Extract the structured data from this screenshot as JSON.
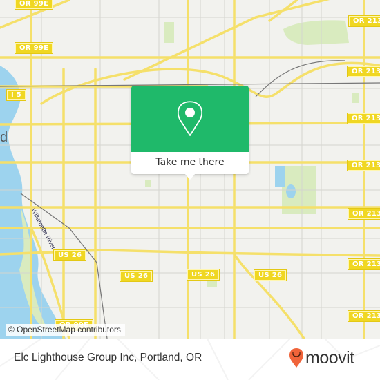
{
  "map": {
    "attribution": "© OpenStreetMap contributors",
    "shields": [
      {
        "id": "or99e-top",
        "label": "OR 99E"
      },
      {
        "id": "or99e-upper",
        "label": "OR 99E"
      },
      {
        "id": "i5",
        "label": "I 5"
      },
      {
        "id": "or213-1",
        "label": "OR 213"
      },
      {
        "id": "or213-2",
        "label": "OR 213"
      },
      {
        "id": "or213-3",
        "label": "OR 213"
      },
      {
        "id": "or213-4",
        "label": "OR 213"
      },
      {
        "id": "or213-5",
        "label": "OR 213"
      },
      {
        "id": "or213-6",
        "label": "OR 213"
      },
      {
        "id": "or213-7",
        "label": "OR 213"
      },
      {
        "id": "us26-1",
        "label": "US 26"
      },
      {
        "id": "us26-2",
        "label": "US 26"
      },
      {
        "id": "us26-3",
        "label": "US 26"
      },
      {
        "id": "us26-4",
        "label": "US 26"
      },
      {
        "id": "or99e-bottom",
        "label": "OR 99E"
      }
    ],
    "labels": {
      "city_fragment": "d",
      "river": "Willamette River"
    },
    "colors": {
      "land": "#f2f2ee",
      "water": "#9dd3ee",
      "park": "#d9ebbf",
      "major_road": "#f5e06a",
      "minor_road": "#cfcfcf",
      "rail": "#777777"
    }
  },
  "popup": {
    "icon": "map-pin-icon",
    "button_label": "Take me there",
    "color": "#1fb96a"
  },
  "footer": {
    "place_title": "Elc Lighthouse Group Inc, Portland, OR",
    "brand": "moovit",
    "brand_color": "#f0643a"
  }
}
